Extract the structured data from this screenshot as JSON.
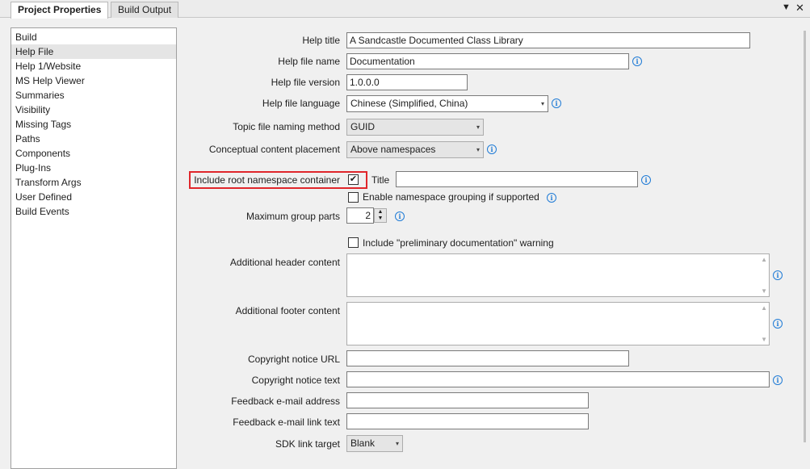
{
  "tabs": [
    {
      "label": "Project Properties",
      "active": true
    },
    {
      "label": "Build Output",
      "active": false
    }
  ],
  "tab_controls": {
    "dropdown_icon": "triangle-down-icon",
    "close_icon": "close-icon"
  },
  "nav": {
    "items": [
      "Build",
      "Help File",
      "Help 1/Website",
      "MS Help Viewer",
      "Summaries",
      "Visibility",
      "Missing Tags",
      "Paths",
      "Components",
      "Plug-Ins",
      "Transform Args",
      "User Defined",
      "Build Events"
    ],
    "selected": "Help File"
  },
  "form": {
    "help_title": {
      "label": "Help title",
      "value": "A Sandcastle Documented Class Library"
    },
    "help_file_name": {
      "label": "Help file name",
      "value": "Documentation"
    },
    "help_file_version": {
      "label": "Help file version",
      "value": "1.0.0.0"
    },
    "help_file_language": {
      "label": "Help file language",
      "value": "Chinese (Simplified, China)"
    },
    "topic_file_naming": {
      "label": "Topic file naming method",
      "value": "GUID"
    },
    "conceptual_placement": {
      "label": "Conceptual content placement",
      "value": "Above namespaces"
    },
    "include_root_ns": {
      "label": "Include root namespace container",
      "checked": true
    },
    "root_title": {
      "label": "Title",
      "value": ""
    },
    "namespace_grouping": {
      "label": "Enable namespace grouping if supported",
      "checked": false
    },
    "max_group_parts": {
      "label": "Maximum group parts",
      "value": "2"
    },
    "preliminary": {
      "label": "Include \"preliminary documentation\" warning",
      "checked": false
    },
    "header_content": {
      "label": "Additional header content",
      "value": ""
    },
    "footer_content": {
      "label": "Additional footer content",
      "value": ""
    },
    "copyright_url": {
      "label": "Copyright notice URL",
      "value": ""
    },
    "copyright_text": {
      "label": "Copyright notice text",
      "value": ""
    },
    "feedback_email": {
      "label": "Feedback e-mail address",
      "value": ""
    },
    "feedback_link_text": {
      "label": "Feedback e-mail link text",
      "value": ""
    },
    "sdk_link_target": {
      "label": "SDK link target",
      "value": "Blank"
    }
  },
  "colors": {
    "highlight_border": "#e0262b",
    "info_icon": "#1f7bd6"
  }
}
